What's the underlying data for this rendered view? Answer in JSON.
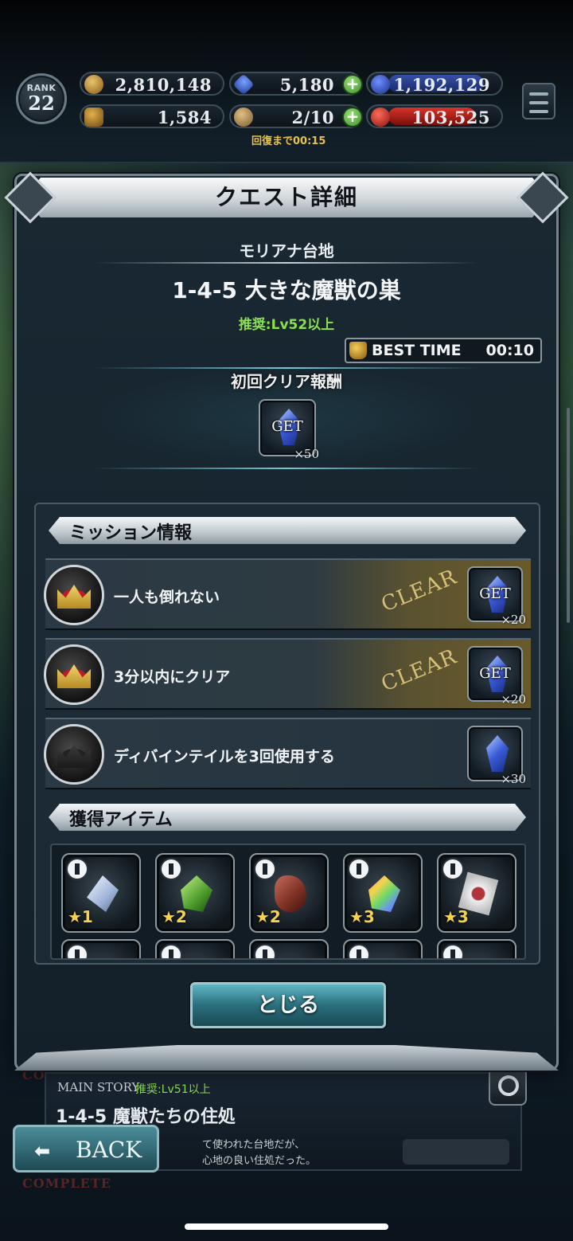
{
  "status": {
    "rank_label": "RANK",
    "rank": "22",
    "gil": "2,810,148",
    "gems": "5,180",
    "blue_points": "1,192,129",
    "trophies": "1,584",
    "stamina": "2/10",
    "red_points": "103,525",
    "recover_text": "回復まで00:15"
  },
  "modal": {
    "title": "クエスト詳細",
    "area": "モリアナ台地",
    "quest_title": "1-4-5 大きな魔獣の巣",
    "recommend": "推奨:Lv52以上",
    "best_time_label": "BEST TIME",
    "best_time": "00:10",
    "first_clear_title": "初回クリア報酬",
    "first_clear_reward": {
      "get": "GET",
      "qty": "×50"
    },
    "mission_header": "ミッション情報",
    "missions": [
      {
        "text": "一人も倒れない",
        "status": "CLEAR",
        "get": "GET",
        "qty": "×20"
      },
      {
        "text": "3分以内にクリア",
        "status": "CLEAR",
        "get": "GET",
        "qty": "×20"
      },
      {
        "text": "ディバインテイルを3回使用する",
        "status": "",
        "get": "",
        "qty": "×30"
      }
    ],
    "items_header": "獲得アイテム",
    "items": [
      {
        "stars": "★1",
        "icon": "white-crystal-icon"
      },
      {
        "stars": "★2",
        "icon": "green-crystal-icon"
      },
      {
        "stars": "★2",
        "icon": "meat-icon"
      },
      {
        "stars": "★3",
        "icon": "rainbow-crystal-icon"
      },
      {
        "stars": "★3",
        "icon": "wrapped-meat-icon"
      }
    ],
    "close_label": "とじる"
  },
  "background": {
    "complete_label": "COMPLETE",
    "card_tag": "MAIN STORY",
    "card_recommend": "推奨:Lv51以上",
    "card_title": "1-4-5 魔獣たちの住処",
    "card_desc_1": "て使われた台地だが、",
    "card_desc_2": "心地の良い住処だった。",
    "back_label": "BACK"
  }
}
